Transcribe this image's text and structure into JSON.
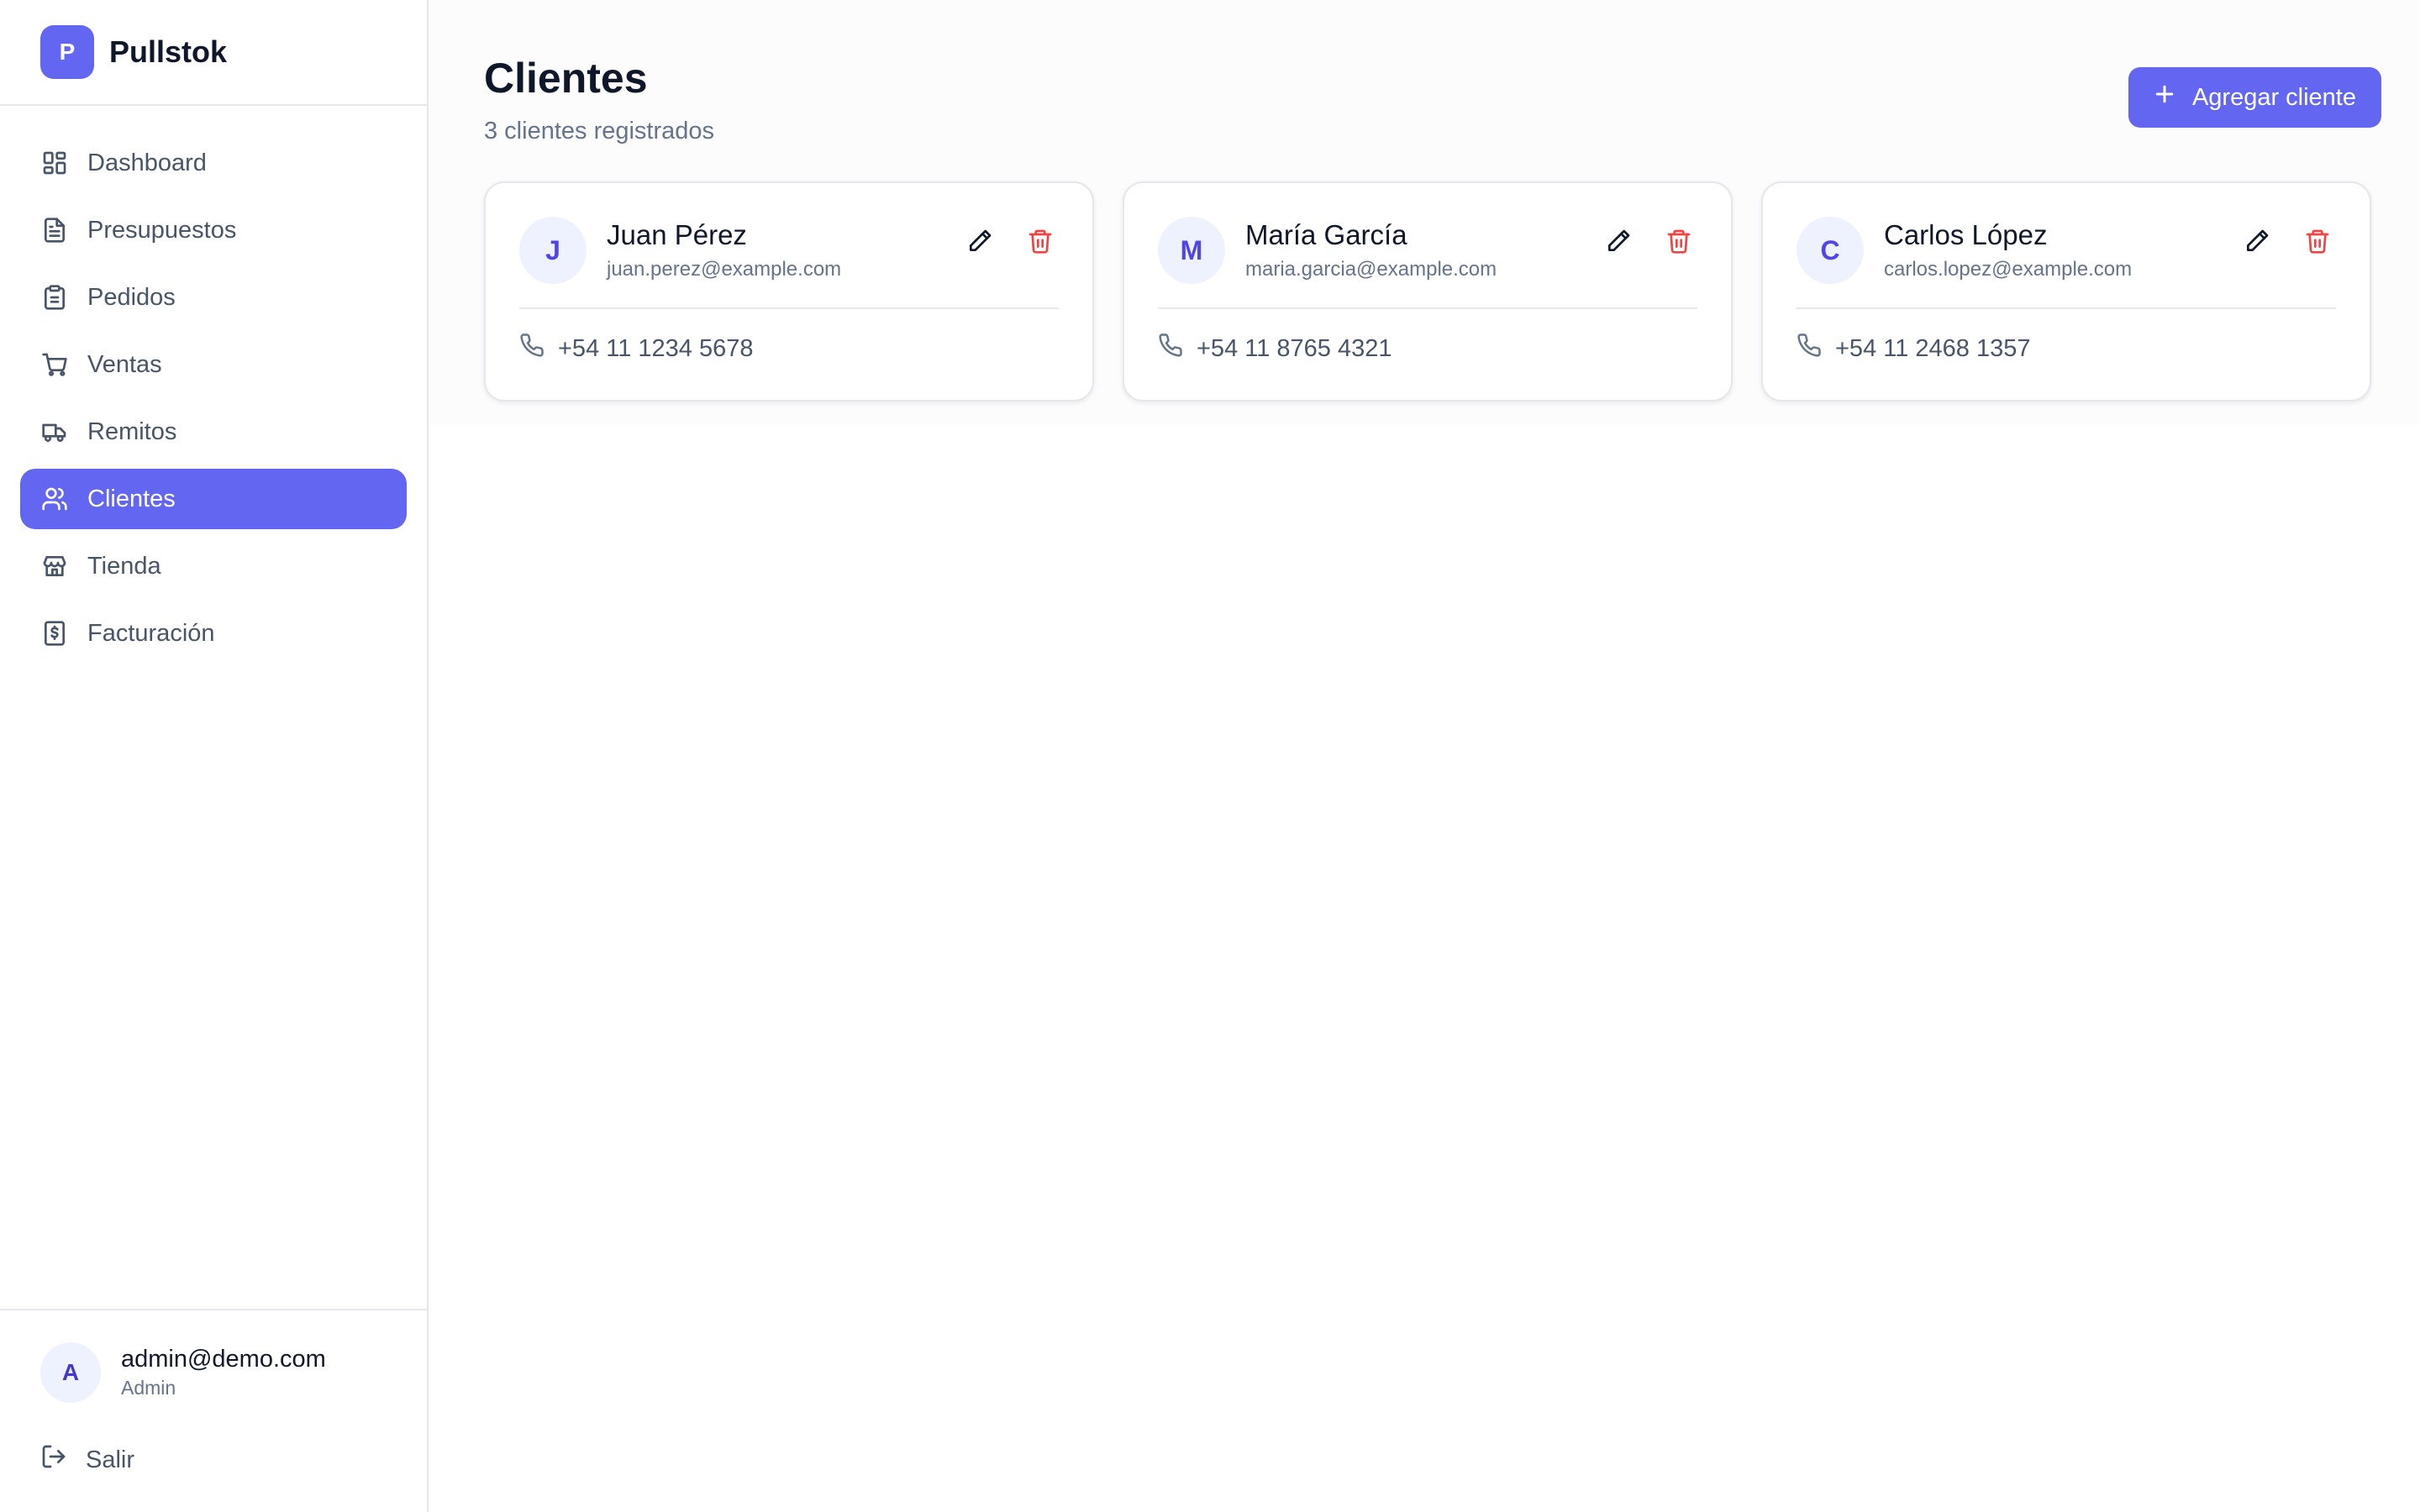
{
  "brand": {
    "logo_letter": "P",
    "name": "Pullstok"
  },
  "sidebar": {
    "items": [
      {
        "label": "Dashboard",
        "icon": "dashboard-icon"
      },
      {
        "label": "Presupuestos",
        "icon": "document-icon"
      },
      {
        "label": "Pedidos",
        "icon": "clipboard-icon"
      },
      {
        "label": "Ventas",
        "icon": "cart-icon"
      },
      {
        "label": "Remitos",
        "icon": "truck-icon"
      },
      {
        "label": "Clientes",
        "icon": "users-icon",
        "active": true
      },
      {
        "label": "Tienda",
        "icon": "store-icon"
      },
      {
        "label": "Facturación",
        "icon": "invoice-icon"
      }
    ]
  },
  "user": {
    "avatar_letter": "A",
    "email": "admin@demo.com",
    "role": "Admin",
    "logout_label": "Salir"
  },
  "header": {
    "title": "Clientes",
    "subtitle": "3 clientes registrados",
    "add_button_label": "Agregar cliente"
  },
  "clients": [
    {
      "initial": "J",
      "name": "Juan Pérez",
      "email": "juan.perez@example.com",
      "phone": "+54 11 1234 5678"
    },
    {
      "initial": "M",
      "name": "María García",
      "email": "maria.garcia@example.com",
      "phone": "+54 11 8765 4321"
    },
    {
      "initial": "C",
      "name": "Carlos López",
      "email": "carlos.lopez@example.com",
      "phone": "+54 11 2468 1357"
    }
  ],
  "colors": {
    "accent": "#6366f1",
    "danger": "#ef4444",
    "muted": "#64748b"
  }
}
